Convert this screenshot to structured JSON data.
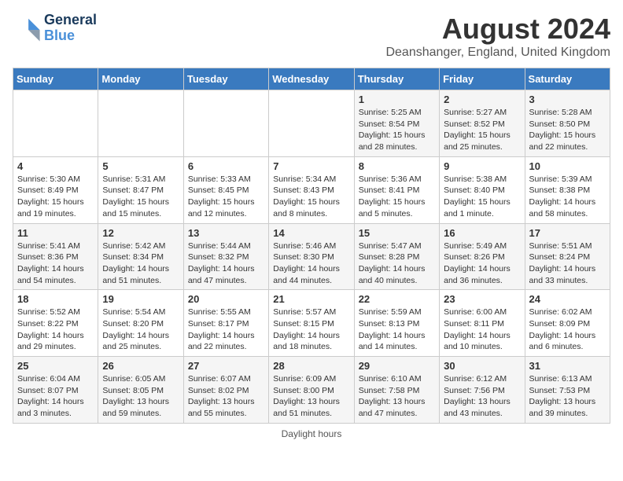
{
  "logo": {
    "line1": "General",
    "line2": "Blue"
  },
  "title": "August 2024",
  "subtitle": "Deanshanger, England, United Kingdom",
  "days_of_week": [
    "Sunday",
    "Monday",
    "Tuesday",
    "Wednesday",
    "Thursday",
    "Friday",
    "Saturday"
  ],
  "footer": "Daylight hours",
  "weeks": [
    [
      {
        "day": "",
        "sunrise": "",
        "sunset": "",
        "daylight": ""
      },
      {
        "day": "",
        "sunrise": "",
        "sunset": "",
        "daylight": ""
      },
      {
        "day": "",
        "sunrise": "",
        "sunset": "",
        "daylight": ""
      },
      {
        "day": "",
        "sunrise": "",
        "sunset": "",
        "daylight": ""
      },
      {
        "day": "1",
        "sunrise": "Sunrise: 5:25 AM",
        "sunset": "Sunset: 8:54 PM",
        "daylight": "Daylight: 15 hours and 28 minutes."
      },
      {
        "day": "2",
        "sunrise": "Sunrise: 5:27 AM",
        "sunset": "Sunset: 8:52 PM",
        "daylight": "Daylight: 15 hours and 25 minutes."
      },
      {
        "day": "3",
        "sunrise": "Sunrise: 5:28 AM",
        "sunset": "Sunset: 8:50 PM",
        "daylight": "Daylight: 15 hours and 22 minutes."
      }
    ],
    [
      {
        "day": "4",
        "sunrise": "Sunrise: 5:30 AM",
        "sunset": "Sunset: 8:49 PM",
        "daylight": "Daylight: 15 hours and 19 minutes."
      },
      {
        "day": "5",
        "sunrise": "Sunrise: 5:31 AM",
        "sunset": "Sunset: 8:47 PM",
        "daylight": "Daylight: 15 hours and 15 minutes."
      },
      {
        "day": "6",
        "sunrise": "Sunrise: 5:33 AM",
        "sunset": "Sunset: 8:45 PM",
        "daylight": "Daylight: 15 hours and 12 minutes."
      },
      {
        "day": "7",
        "sunrise": "Sunrise: 5:34 AM",
        "sunset": "Sunset: 8:43 PM",
        "daylight": "Daylight: 15 hours and 8 minutes."
      },
      {
        "day": "8",
        "sunrise": "Sunrise: 5:36 AM",
        "sunset": "Sunset: 8:41 PM",
        "daylight": "Daylight: 15 hours and 5 minutes."
      },
      {
        "day": "9",
        "sunrise": "Sunrise: 5:38 AM",
        "sunset": "Sunset: 8:40 PM",
        "daylight": "Daylight: 15 hours and 1 minute."
      },
      {
        "day": "10",
        "sunrise": "Sunrise: 5:39 AM",
        "sunset": "Sunset: 8:38 PM",
        "daylight": "Daylight: 14 hours and 58 minutes."
      }
    ],
    [
      {
        "day": "11",
        "sunrise": "Sunrise: 5:41 AM",
        "sunset": "Sunset: 8:36 PM",
        "daylight": "Daylight: 14 hours and 54 minutes."
      },
      {
        "day": "12",
        "sunrise": "Sunrise: 5:42 AM",
        "sunset": "Sunset: 8:34 PM",
        "daylight": "Daylight: 14 hours and 51 minutes."
      },
      {
        "day": "13",
        "sunrise": "Sunrise: 5:44 AM",
        "sunset": "Sunset: 8:32 PM",
        "daylight": "Daylight: 14 hours and 47 minutes."
      },
      {
        "day": "14",
        "sunrise": "Sunrise: 5:46 AM",
        "sunset": "Sunset: 8:30 PM",
        "daylight": "Daylight: 14 hours and 44 minutes."
      },
      {
        "day": "15",
        "sunrise": "Sunrise: 5:47 AM",
        "sunset": "Sunset: 8:28 PM",
        "daylight": "Daylight: 14 hours and 40 minutes."
      },
      {
        "day": "16",
        "sunrise": "Sunrise: 5:49 AM",
        "sunset": "Sunset: 8:26 PM",
        "daylight": "Daylight: 14 hours and 36 minutes."
      },
      {
        "day": "17",
        "sunrise": "Sunrise: 5:51 AM",
        "sunset": "Sunset: 8:24 PM",
        "daylight": "Daylight: 14 hours and 33 minutes."
      }
    ],
    [
      {
        "day": "18",
        "sunrise": "Sunrise: 5:52 AM",
        "sunset": "Sunset: 8:22 PM",
        "daylight": "Daylight: 14 hours and 29 minutes."
      },
      {
        "day": "19",
        "sunrise": "Sunrise: 5:54 AM",
        "sunset": "Sunset: 8:20 PM",
        "daylight": "Daylight: 14 hours and 25 minutes."
      },
      {
        "day": "20",
        "sunrise": "Sunrise: 5:55 AM",
        "sunset": "Sunset: 8:17 PM",
        "daylight": "Daylight: 14 hours and 22 minutes."
      },
      {
        "day": "21",
        "sunrise": "Sunrise: 5:57 AM",
        "sunset": "Sunset: 8:15 PM",
        "daylight": "Daylight: 14 hours and 18 minutes."
      },
      {
        "day": "22",
        "sunrise": "Sunrise: 5:59 AM",
        "sunset": "Sunset: 8:13 PM",
        "daylight": "Daylight: 14 hours and 14 minutes."
      },
      {
        "day": "23",
        "sunrise": "Sunrise: 6:00 AM",
        "sunset": "Sunset: 8:11 PM",
        "daylight": "Daylight: 14 hours and 10 minutes."
      },
      {
        "day": "24",
        "sunrise": "Sunrise: 6:02 AM",
        "sunset": "Sunset: 8:09 PM",
        "daylight": "Daylight: 14 hours and 6 minutes."
      }
    ],
    [
      {
        "day": "25",
        "sunrise": "Sunrise: 6:04 AM",
        "sunset": "Sunset: 8:07 PM",
        "daylight": "Daylight: 14 hours and 3 minutes."
      },
      {
        "day": "26",
        "sunrise": "Sunrise: 6:05 AM",
        "sunset": "Sunset: 8:05 PM",
        "daylight": "Daylight: 13 hours and 59 minutes."
      },
      {
        "day": "27",
        "sunrise": "Sunrise: 6:07 AM",
        "sunset": "Sunset: 8:02 PM",
        "daylight": "Daylight: 13 hours and 55 minutes."
      },
      {
        "day": "28",
        "sunrise": "Sunrise: 6:09 AM",
        "sunset": "Sunset: 8:00 PM",
        "daylight": "Daylight: 13 hours and 51 minutes."
      },
      {
        "day": "29",
        "sunrise": "Sunrise: 6:10 AM",
        "sunset": "Sunset: 7:58 PM",
        "daylight": "Daylight: 13 hours and 47 minutes."
      },
      {
        "day": "30",
        "sunrise": "Sunrise: 6:12 AM",
        "sunset": "Sunset: 7:56 PM",
        "daylight": "Daylight: 13 hours and 43 minutes."
      },
      {
        "day": "31",
        "sunrise": "Sunrise: 6:13 AM",
        "sunset": "Sunset: 7:53 PM",
        "daylight": "Daylight: 13 hours and 39 minutes."
      }
    ]
  ]
}
